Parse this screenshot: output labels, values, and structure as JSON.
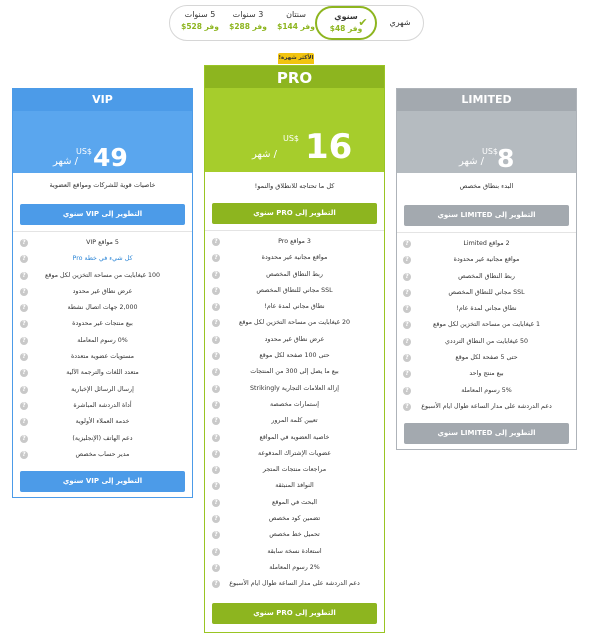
{
  "toggle": {
    "monthly": "شهري",
    "yearly": {
      "label": "سنوي",
      "save": "وفر 48$"
    },
    "two_years": {
      "label": "سنتان",
      "save": "وفر 144$"
    },
    "three_years": {
      "label": "3 سنوات",
      "save": "وفر 288$"
    },
    "five_years": {
      "label": "5 سنوات",
      "save": "وفر 528$"
    },
    "selected": "yearly",
    "check_icon": "✔"
  },
  "badge": "الأكثر شهرة!",
  "colors": {
    "vip": "#4c9be8",
    "pro": "#8db51f",
    "limited": "#a3a9af",
    "badge": "#f2c410"
  },
  "plans": {
    "vip": {
      "name": "VIP",
      "price": "49",
      "currency": "US$",
      "per": "/ شهر",
      "billing_note": "USD الدفع سنوي",
      "tagline": "خاصيات قوية للشركات ومواقع العضوية",
      "cta": "التطوير إلى VIP سنوي",
      "features": [
        "5 مواقع VIP",
        "كل شيء في خطة Pro",
        "100 غيغابايت من مساحة التخزين لكل موقع",
        "عرض نطاق غير محدود",
        "2,000 جهات اتصال نشطة",
        "بيع منتجات غير محدودة",
        "0% رسوم المعاملة",
        "مستويات عضوية متعددة",
        "متعدد اللغات والترجمة الآلية",
        "إرسال الرسائل الإخبارية",
        "أداة الدردشة المباشرة",
        "خدمة العملاء الأولوية",
        "دعم الهاتف (الإنجليزية)",
        "مدير حساب مخصص"
      ]
    },
    "pro": {
      "name": "PRO",
      "price": "16",
      "currency": "US$",
      "per": "/ شهر",
      "billing_note": "USD الدفع سنوي",
      "tagline": "كل ما تحتاجه للانطلاق والنمو!",
      "cta": "التطوير إلى PRO سنوي",
      "features": [
        "3 مواقع Pro",
        "مواقع مجانية غير محدودة",
        "ربط النطاق المخصص",
        "SSL مجاني للنطاق المخصص",
        "نطاق مجاني لمدة عام!",
        "20 غيغابايت من مساحة التخزين لكل موقع",
        "عرض نطاق غير محدود",
        "حتى 100 صفحة لكل موقع",
        "بيع ما يصل إلى 300 من المنتجات",
        "إزالة العلامات التجارية Strikingly",
        "إستمارات مخصصة",
        "تعيين كلمة المرور",
        "خاصية العضوية في المواقع",
        "عضويات الإشتراك المدفوعة",
        "مراجعات منتجات المتجر",
        "النوافذ المنبثقة",
        "البحث في الموقع",
        "تضمين كود مخصص",
        "تحميل خط مخصص",
        "استعادة نسخة سابقة",
        "2% رسوم المعاملة",
        "دعم الدردشة على مدار الساعة طوال ايام الأسبوع"
      ]
    },
    "limited": {
      "name": "LIMITED",
      "price": "8",
      "currency": "US$",
      "per": "/ شهر",
      "billing_note": "USD الدفع سنوي",
      "tagline": "البدء بنطاق مخصص",
      "cta": "التطوير إلى LIMITED سنوي",
      "features": [
        "2 مواقع Limited",
        "مواقع مجانية غير محدودة",
        "ربط النطاق المخصص",
        "SSL مجاني للنطاق المخصص",
        "نطاق مجاني لمدة عام!",
        "1 غيغابايت من مساحة التخزين لكل موقع",
        "50 غيغابايت من النطاق الترددي",
        "حتى 5 صفحة لكل موقع",
        "بيع منتج واحد",
        "5% رسوم المعاملة",
        "دعم الدردشة على مدار الساعة طوال ايام الأسبوع"
      ]
    }
  },
  "info_icon": "?"
}
